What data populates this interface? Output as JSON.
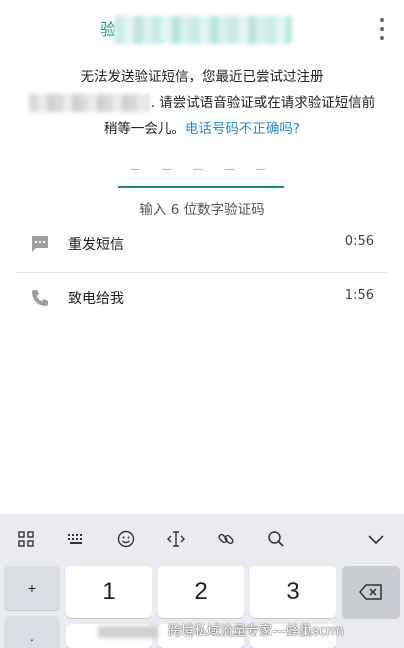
{
  "header": {
    "title_prefix": "验",
    "menu_icon": "more-vertical-icon"
  },
  "message": {
    "line1": "无法发送验证短信，您最近已尝试过注册",
    "line2_suffix": ". 请尝试语音验证或在请求验证短信前",
    "line3": "稍等一会儿。",
    "link": "电话号码不正确吗?"
  },
  "code_input": {
    "placeholder": "— — —   — — —",
    "hint": "输入 6 位数字验证码"
  },
  "options": {
    "resend": {
      "label": "重发短信",
      "time": "0:56",
      "icon": "message-icon"
    },
    "call": {
      "label": "致电给我",
      "time": "1:56",
      "icon": "phone-icon"
    }
  },
  "keyboard": {
    "toolbar_icons": [
      "grid-icon",
      "keypad-icon",
      "emoji-icon",
      "cursor-icon",
      "link-icon",
      "search-icon",
      "collapse-icon"
    ],
    "keys": {
      "plus": "+",
      "dot": ".",
      "k1": "1",
      "k2": "2",
      "k3": "3",
      "delete_icon": "backspace-icon"
    }
  },
  "watermark": {
    "text": "跨境私域流量专家---蜂巢scrm"
  },
  "colors": {
    "accent": "#128c7e",
    "link": "#1d8fd6",
    "keyboard_bg": "#e9ebf0"
  }
}
